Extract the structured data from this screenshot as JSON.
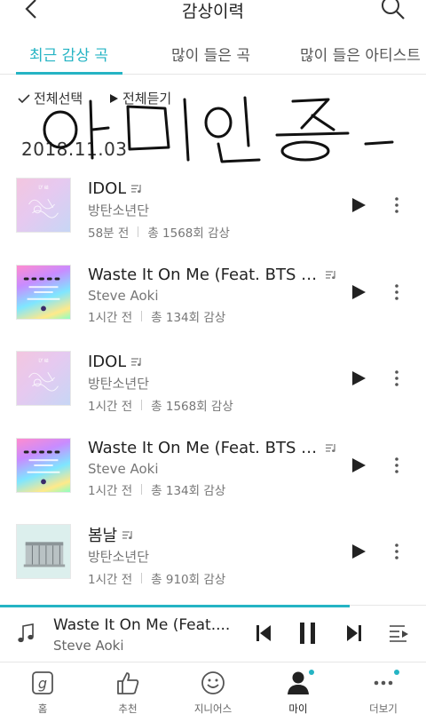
{
  "header": {
    "title": "감상이력",
    "back_icon": "chevron-left-icon",
    "search_icon": "search-icon"
  },
  "tabs": [
    {
      "label": "최근 감상 곡",
      "active": true
    },
    {
      "label": "많이 들은 곡",
      "active": false
    },
    {
      "label": "많이 들은 아티스트",
      "active": false
    }
  ],
  "actions": {
    "select_all": "전체선택",
    "play_all": "전체듣기"
  },
  "date": "2018.11.03",
  "songs": [
    {
      "title": "IDOL",
      "artist": "방탄소년단",
      "time": "58분 전",
      "plays": "총 1568회 감상",
      "art": "idol"
    },
    {
      "title": "Waste It On Me (Feat. BTS (…",
      "artist": "Steve Aoki",
      "time": "1시간 전",
      "plays": "총 134회 감상",
      "art": "waste"
    },
    {
      "title": "IDOL",
      "artist": "방탄소년단",
      "time": "1시간 전",
      "plays": "총 1568회 감상",
      "art": "idol"
    },
    {
      "title": "Waste It On Me (Feat. BTS (…",
      "artist": "Steve Aoki",
      "time": "1시간 전",
      "plays": "총 134회 감상",
      "art": "waste"
    },
    {
      "title": "봄날",
      "artist": "방탄소년단",
      "time": "1시간 전",
      "plays": "총 910회 감상",
      "art": "spring"
    }
  ],
  "player": {
    "title": "Waste It On Me (Feat....",
    "artist": "Steve Aoki",
    "progress": 0.82
  },
  "nav": [
    {
      "label": "홈",
      "icon": "home-icon"
    },
    {
      "label": "추천",
      "icon": "thumbs-up-icon"
    },
    {
      "label": "지니어스",
      "icon": "smiley-icon"
    },
    {
      "label": "마이",
      "icon": "person-icon",
      "active": true
    },
    {
      "label": "더보기",
      "icon": "more-horizontal-icon"
    }
  ],
  "colors": {
    "accent": "#25b4c4"
  }
}
